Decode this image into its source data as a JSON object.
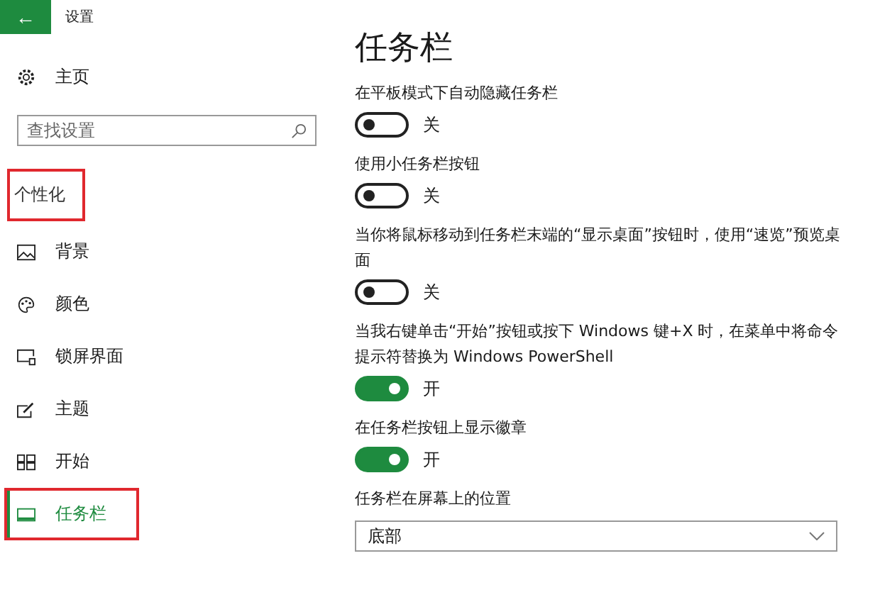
{
  "window": {
    "title": "设置",
    "back_button": "←"
  },
  "sidebar": {
    "home": "主页",
    "search": {
      "placeholder": "查找设置"
    },
    "section": {
      "label": "个性化",
      "highlighted": true
    },
    "items": [
      {
        "label": "背景",
        "selected": false,
        "highlighted": false
      },
      {
        "label": "颜色",
        "selected": false,
        "highlighted": false
      },
      {
        "label": "锁屏界面",
        "selected": false,
        "highlighted": false
      },
      {
        "label": "主题",
        "selected": false,
        "highlighted": false
      },
      {
        "label": "开始",
        "selected": false,
        "highlighted": false
      },
      {
        "label": "任务栏",
        "selected": true,
        "highlighted": true
      }
    ]
  },
  "content": {
    "title": "任务栏",
    "settings": [
      {
        "kind": "toggle",
        "label": "在平板模式下自动隐藏任务栏",
        "on": false,
        "state_text": "关"
      },
      {
        "kind": "toggle",
        "label": "使用小任务栏按钮",
        "on": false,
        "state_text": "关"
      },
      {
        "kind": "toggle",
        "label": "当你将鼠标移动到任务栏末端的“显示桌面”按钮时，使用“速览”预览桌面",
        "on": false,
        "state_text": "关"
      },
      {
        "kind": "toggle",
        "label": "当我右键单击“开始”按钮或按下 Windows 键+X 时，在菜单中将命令提示符替换为 Windows PowerShell",
        "on": true,
        "state_text": "开"
      },
      {
        "kind": "toggle",
        "label": "在任务栏按钮上显示徽章",
        "on": true,
        "state_text": "开"
      },
      {
        "kind": "dropdown",
        "label": "任务栏在屏幕上的位置",
        "value": "底部"
      }
    ]
  }
}
